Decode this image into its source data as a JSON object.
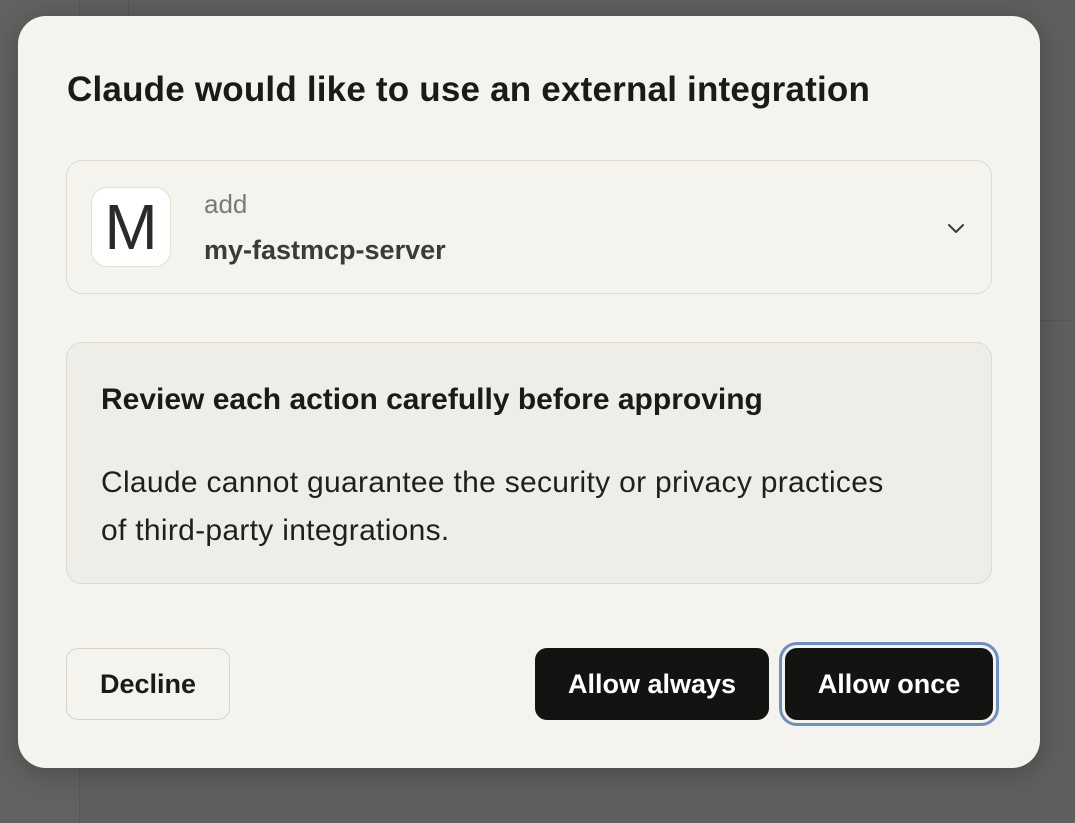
{
  "dialog": {
    "title": "Claude would like to use an external integration",
    "tool": {
      "avatar_letter": "M",
      "action": "add",
      "server": "my-fastmcp-server",
      "expand_icon": "chevron-down-icon"
    },
    "warning": {
      "heading": "Review each action carefully before approving",
      "body": "Claude cannot guarantee the security or privacy practices of third-party integrations."
    },
    "buttons": {
      "decline": "Decline",
      "allow_always": "Allow always",
      "allow_once": "Allow once"
    }
  },
  "colors": {
    "overlay": "#5f5f5d",
    "dialog_bg": "#f4f3ee",
    "primary_button": "#131312",
    "focus_ring": "#6e8fbf"
  }
}
